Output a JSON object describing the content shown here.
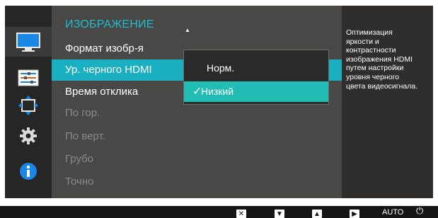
{
  "menu": {
    "title": "ИЗОБРАЖЕНИЕ",
    "scroll_up_glyph": "▲",
    "items": [
      {
        "label": "Формат изобр-я",
        "state": "enabled"
      },
      {
        "label": "Ур. черного HDMI",
        "state": "selected"
      },
      {
        "label": "Время отклика",
        "state": "enabled"
      },
      {
        "label": "По гор.",
        "state": "disabled"
      },
      {
        "label": "По верт.",
        "state": "disabled"
      },
      {
        "label": "Грубо",
        "state": "disabled"
      },
      {
        "label": "Точно",
        "state": "disabled"
      }
    ]
  },
  "submenu": {
    "options": [
      {
        "label": "Норм.",
        "selected": false
      },
      {
        "label": "Низкий",
        "selected": true
      }
    ],
    "check_glyph": "✓"
  },
  "info": {
    "text": "Оптимизация\nяркости и\nконтрастности\nизображения HDMI\nпутем настройки\nуровня черного\nцвета видеосигнала."
  },
  "sidebar": {
    "icons": [
      "monitor-icon",
      "color-adjust-icon",
      "size-position-icon",
      "settings-gear-icon",
      "info-icon"
    ],
    "selected_index": 0
  },
  "button_bar": {
    "buttons": [
      {
        "icon": "close-icon",
        "glyph": "✕"
      },
      {
        "icon": "down-arrow-icon",
        "glyph": "▼"
      },
      {
        "icon": "up-arrow-icon",
        "glyph": "▲"
      },
      {
        "icon": "enter-arrow-icon",
        "glyph": "▶"
      },
      {
        "icon": "auto-label",
        "text": "AUTO"
      },
      {
        "icon": "power-icon",
        "glyph": "⏻"
      }
    ]
  },
  "colors": {
    "accent": "#21bcd0",
    "selection": "#1ab0c1",
    "submenu_selection": "#21bcb4",
    "background": "#302e2d",
    "menu_panel": "#484847",
    "disabled_text": "#8a8a8a"
  }
}
